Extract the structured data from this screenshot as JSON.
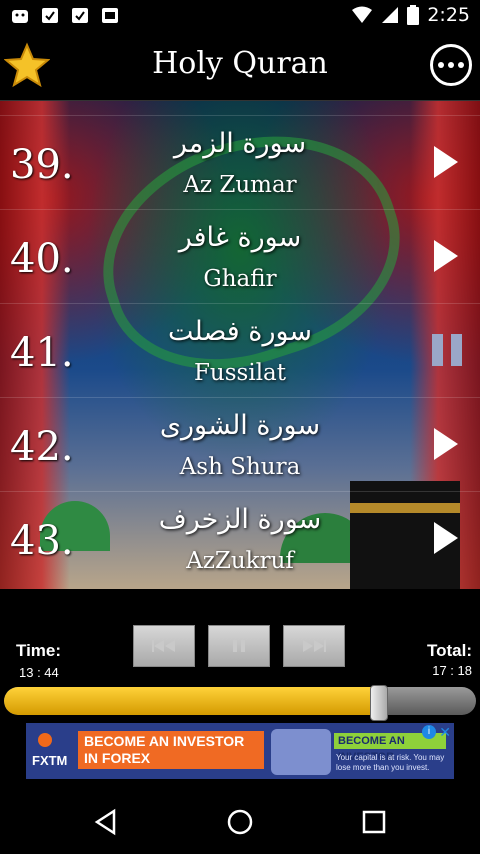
{
  "status_bar": {
    "time": "2:25"
  },
  "header": {
    "title": "Holy Quran"
  },
  "surahs": [
    {
      "number": "39.",
      "arabic": "سورة الزمر",
      "name": "Az Zumar",
      "state": "play"
    },
    {
      "number": "40.",
      "arabic": "سورة غافر",
      "name": "Ghafir",
      "state": "play"
    },
    {
      "number": "41.",
      "arabic": "سورة فصلت",
      "name": "Fussilat",
      "state": "pause"
    },
    {
      "number": "42.",
      "arabic": "سورة الشورى",
      "name": "Ash Shura",
      "state": "play"
    },
    {
      "number": "43.",
      "arabic": "سورة الزخرف",
      "name": "AzZukruf",
      "state": "play"
    }
  ],
  "player": {
    "time_label": "Time:",
    "time_value": "13 : 44",
    "total_label": "Total:",
    "total_value": "17 : 18",
    "progress_fraction": 0.794
  },
  "ad": {
    "brand": "FXTM",
    "headline": "BECOME AN INVESTOR IN FOREX",
    "tag": "BECOME AN INVESTOR",
    "disclaimer": "Your capital is at risk. You may lose more than you invest."
  },
  "colors": {
    "accent_gold": "#f5c228",
    "seek_fill": "#ffd23a"
  }
}
